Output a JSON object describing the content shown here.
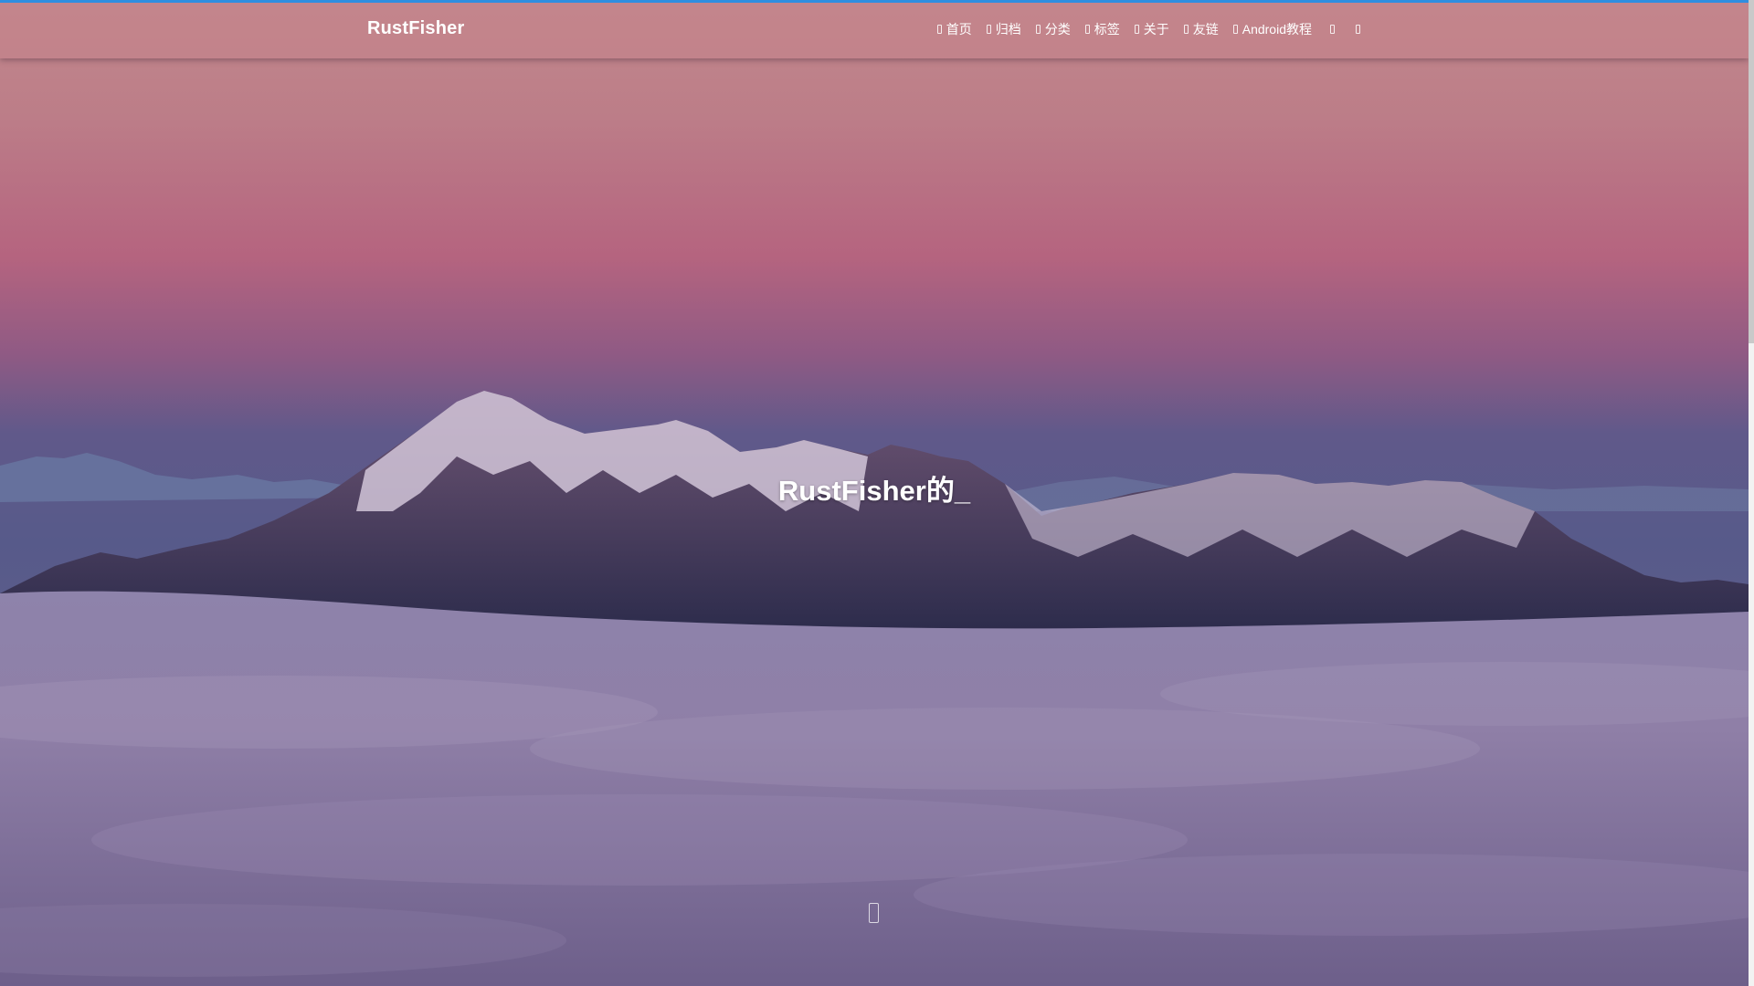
{
  "site": {
    "brand": "RustFisher"
  },
  "nav": {
    "items": [
      {
        "icon": "home-icon",
        "label": "首页"
      },
      {
        "icon": "archive-icon",
        "label": "归档"
      },
      {
        "icon": "folder-icon",
        "label": "分类"
      },
      {
        "icon": "tags-icon",
        "label": "标签"
      },
      {
        "icon": "user-icon",
        "label": "关于"
      },
      {
        "icon": "link-icon",
        "label": "友链"
      },
      {
        "icon": "book-icon",
        "label": "Android教程"
      }
    ],
    "tools": [
      {
        "icon": "search-icon"
      },
      {
        "icon": "theme-toggle-icon"
      }
    ]
  },
  "hero": {
    "title": "RustFisher的_"
  },
  "colors": {
    "progress_bar": "#2f8ee0",
    "sky_top": "#c2858b",
    "sky_mid": "#b8627f",
    "sky_low": "#545789",
    "clouds": "#8f80a6"
  }
}
